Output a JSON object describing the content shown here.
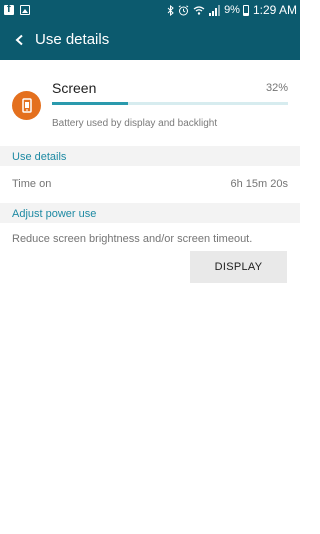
{
  "status_bar": {
    "left_icons": [
      "facebook-icon",
      "gallery-icon"
    ],
    "right_icons": [
      "bluetooth-icon",
      "alarm-icon",
      "wifi-icon",
      "signal-icon",
      "battery-icon"
    ],
    "battery_pct": "9%",
    "time": "1:29 AM"
  },
  "app_bar": {
    "back_icon": "chevron-left-icon",
    "title": "Use details"
  },
  "usage_item": {
    "icon": "screen-phone-icon",
    "icon_color": "#e4701e",
    "name": "Screen",
    "percent": "32%",
    "percent_value": 0.32,
    "description": "Battery used by display and backlight"
  },
  "use_details": {
    "header": "Use details",
    "rows": [
      {
        "label": "Time on",
        "value": "6h 15m 20s"
      }
    ]
  },
  "adjust_power": {
    "header": "Adjust power use",
    "text": "Reduce screen brightness and/or screen timeout.",
    "button_label": "DISPLAY"
  },
  "colors": {
    "app_bar": "#0c5a6e",
    "accent": "#1e8aa3",
    "progress": "#2a9aad",
    "section_bg": "#f3f3f3"
  }
}
